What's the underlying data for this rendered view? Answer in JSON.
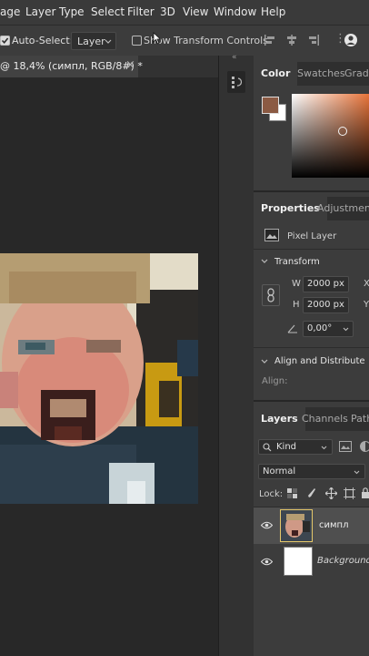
{
  "menu": [
    "age",
    "Layer",
    "Type",
    "Select",
    "Filter",
    "3D",
    "View",
    "Window",
    "Help"
  ],
  "options_bar": {
    "auto_select_label": "Auto-Select:",
    "auto_select_checked": true,
    "layer_dropdown": "Layer",
    "transform_controls_label": "Show Transform Controls",
    "transform_controls_checked": false
  },
  "document_tab": {
    "title": "@ 18,4% (симпл, RGB/8#) *",
    "close": "×"
  },
  "color_panel": {
    "tabs": [
      "Color",
      "Swatches",
      "Gradie"
    ],
    "foreground_color": "#8b5a43",
    "background_color": "#ffffff",
    "picker_hue_color": "#e8743a"
  },
  "properties_panel": {
    "tabs": [
      "Properties",
      "Adjustments"
    ],
    "kind_label": "Pixel Layer",
    "transform_header": "Transform",
    "width_label": "W",
    "width_value": "2000 px",
    "height_label": "H",
    "height_value": "2000 px",
    "x_label": "X",
    "y_label": "Y",
    "angle_value": "0,00°",
    "align_header": "Align and Distribute",
    "align_label": "Align:"
  },
  "layers_panel": {
    "tabs": [
      "Layers",
      "Channels",
      "Path"
    ],
    "filter_label": "Kind",
    "blend_mode": "Normal",
    "lock_label": "Lock:",
    "layers": [
      {
        "name": "симпл",
        "visible": true,
        "selected": true
      },
      {
        "name": "Background",
        "visible": true,
        "selected": false
      }
    ]
  }
}
